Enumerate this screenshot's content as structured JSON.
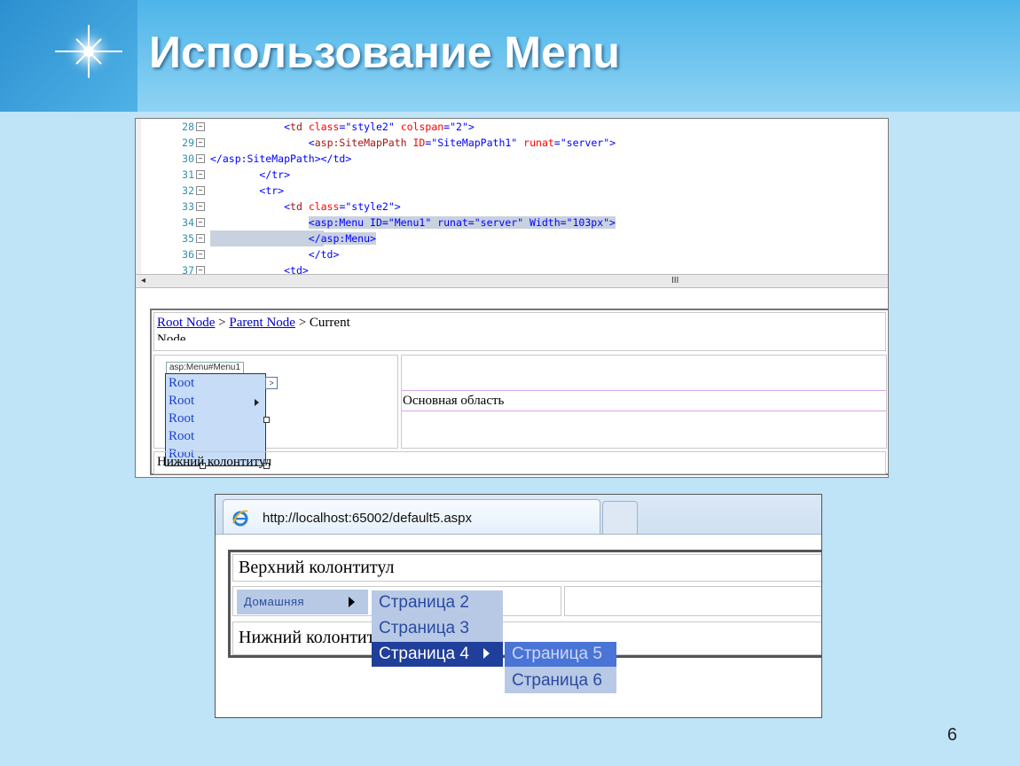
{
  "slide": {
    "title": "Использование Menu",
    "page_number": "6"
  },
  "code_editor": {
    "lines": [
      {
        "num": "28",
        "prefix": "            ",
        "tag_open": "<td ",
        "attrs": [
          {
            "name": "class",
            "value": "\"style2\""
          },
          {
            "name": "colspan",
            "value": "\"2\""
          }
        ],
        "tag_close": ">",
        "highlight": false
      },
      {
        "num": "29",
        "prefix": "                ",
        "tag_open": "<asp:SiteMapPath ",
        "attrs": [
          {
            "name": "ID",
            "value": "\"SiteMapPath1\""
          },
          {
            "name": "runat",
            "value": "\"server\""
          }
        ],
        "tag_close": ">",
        "highlight": false
      },
      {
        "num": "30",
        "prefix": "",
        "text": "</asp:SiteMapPath></td>",
        "highlight": false
      },
      {
        "num": "31",
        "prefix": "        ",
        "text": "</tr>",
        "highlight": false
      },
      {
        "num": "32",
        "prefix": "        ",
        "text": "<tr>",
        "highlight": false
      },
      {
        "num": "33",
        "prefix": "            ",
        "tag_open": "<td ",
        "attrs": [
          {
            "name": "class",
            "value": "\"style2\""
          }
        ],
        "tag_close": ">",
        "highlight": false
      },
      {
        "num": "34",
        "prefix": "                ",
        "text": "<asp:Menu ID=\"Menu1\" runat=\"server\" Width=\"103px\">",
        "highlight": true
      },
      {
        "num": "35",
        "prefix": "                ",
        "text": "</asp:Menu>",
        "highlight": true
      },
      {
        "num": "36",
        "prefix": "                ",
        "text": "</td>",
        "highlight": false
      },
      {
        "num": "37",
        "prefix": "            ",
        "text": "<td>",
        "highlight": false
      }
    ],
    "scrollbar_grip": "III"
  },
  "designer": {
    "breadcrumb": {
      "root": "Root Node",
      "sep1": " > ",
      "parent": "Parent Node",
      "sep2": " > ",
      "current": "Current"
    },
    "breadcrumb_overflow": "Node",
    "menu_tag": "asp:Menu#Menu1",
    "menu_items": [
      "Root",
      "Root",
      "Root",
      "Root",
      "Root"
    ],
    "smart_tag": ">",
    "main_area": "Основная область",
    "footer": "Нижний колонтитул"
  },
  "browser": {
    "url": "http://localhost:65002/default5.aspx",
    "header_text": "Верхний колонтитул",
    "footer_text": "Нижний колонтитул",
    "menu_root": "Домашняя",
    "submenu": [
      "Страница 2",
      "Страница 3",
      "Страница 4"
    ],
    "submenu2": [
      "Страница 5",
      "Страница 6"
    ]
  }
}
